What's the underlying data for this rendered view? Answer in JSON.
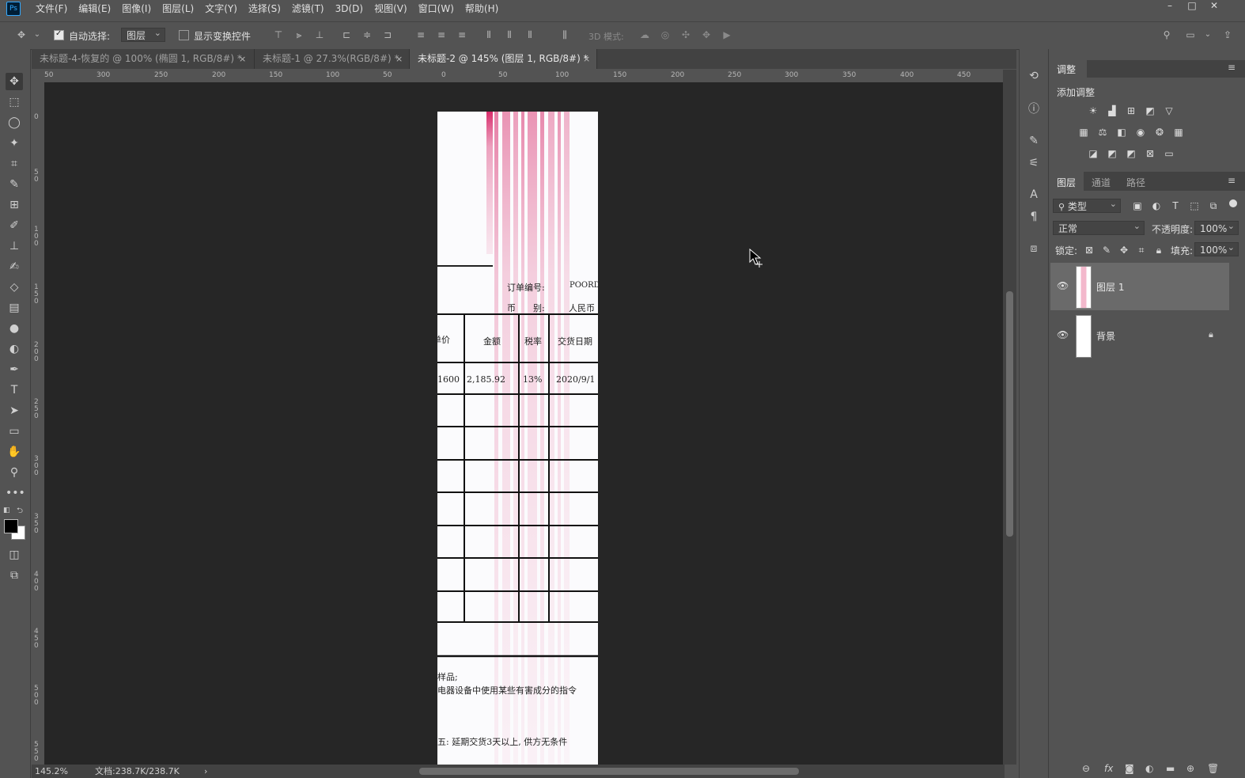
{
  "app": {
    "logo": "Ps"
  },
  "menu": [
    "文件(F)",
    "编辑(E)",
    "图像(I)",
    "图层(L)",
    "文字(Y)",
    "选择(S)",
    "滤镜(T)",
    "3D(D)",
    "视图(V)",
    "窗口(W)",
    "帮助(H)"
  ],
  "window_controls": {
    "minimize": "–",
    "maximize": "□",
    "close": "✕"
  },
  "options": {
    "auto_select_label": "自动选择:",
    "auto_select_checked": true,
    "auto_select_target": "图层",
    "show_transform_label": "显示变换控件",
    "show_transform_checked": false,
    "mode_3d_label": "3D 模式:"
  },
  "tabs": [
    {
      "label": "未标题-4-恢复的 @ 100% (椭圆 1, RGB/8#) *",
      "active": false
    },
    {
      "label": "未标题-1 @ 27.3%(RGB/8#) *",
      "active": false
    },
    {
      "label": "未标题-2 @ 145% (图层 1, RGB/8#) *",
      "active": true
    }
  ],
  "tab_close": "×",
  "ruler_top": [
    "50",
    "300",
    "250",
    "200",
    "150",
    "100",
    "50",
    "0",
    "50",
    "100",
    "150",
    "200",
    "250",
    "300",
    "350",
    "400",
    "450"
  ],
  "ruler_left": [
    "0",
    "5\n0",
    "1\n0\n0",
    "1\n5\n0",
    "2\n0\n0",
    "2\n5\n0",
    "3\n0\n0",
    "3\n5\n0",
    "4\n0\n0",
    "4\n5\n0",
    "5\n0\n0",
    "5\n5\n0"
  ],
  "document": {
    "order_no_label": "订单编号:",
    "order_no_value": "POORD(",
    "currency_label": "币　　别:",
    "currency_value": "人民币",
    "headers": [
      "单价",
      "金额",
      "税率",
      "交货日期"
    ],
    "row": [
      "1600",
      "2,185.92",
      "13%",
      "2020/9/1"
    ],
    "note1": "样品;",
    "note2": "电器设备中使用某些有害成分的指令",
    "note3": "五: 延期交货3天以上, 供方无条件"
  },
  "status": {
    "zoom": "145.2%",
    "doc_size": "文档:238.7K/238.7K",
    "arrow": "›"
  },
  "adjustments": {
    "tab": "调整",
    "add_label": "添加调整"
  },
  "layers_panel": {
    "tabs": [
      "图层",
      "通道",
      "路径"
    ],
    "filter_kind": "类型",
    "blend_mode": "正常",
    "opacity_label": "不透明度:",
    "opacity_value": "100%",
    "lock_label": "锁定:",
    "fill_label": "填充:",
    "fill_value": "100%",
    "layers": [
      {
        "name": "图层 1",
        "visible": true,
        "active": true,
        "locked": false
      },
      {
        "name": "背景",
        "visible": true,
        "active": false,
        "locked": true
      }
    ]
  },
  "colors": {
    "accent": "#31a8ff",
    "ui_bg": "#535353",
    "canvas_bg": "#262626",
    "stamp": "#d6336c"
  }
}
